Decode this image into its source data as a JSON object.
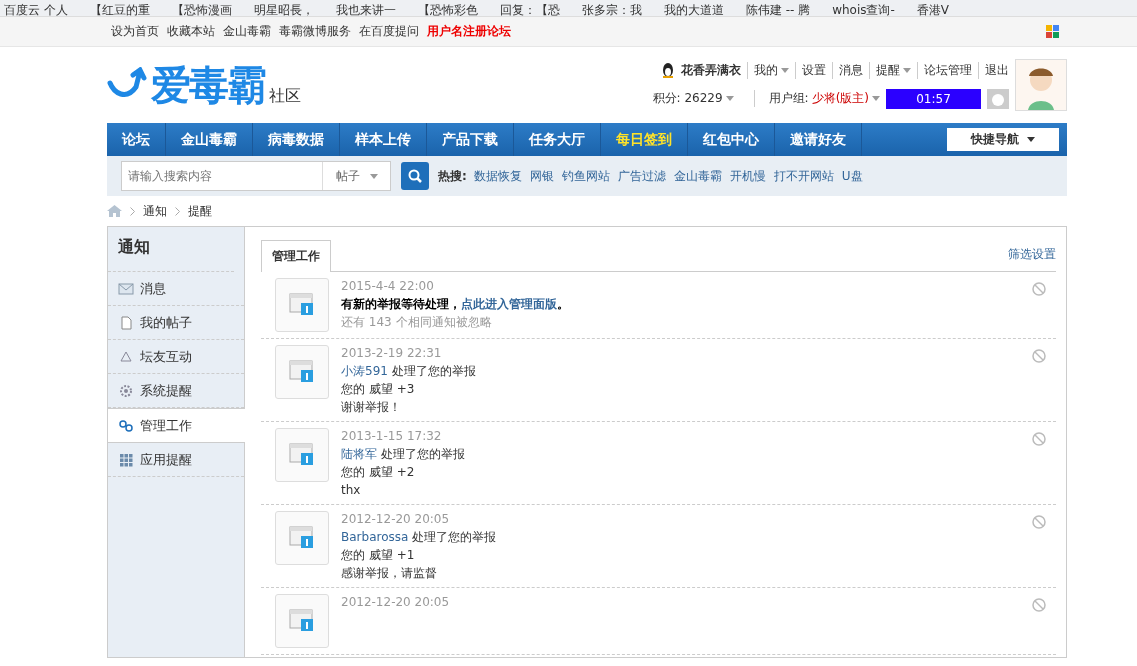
{
  "bookmarks": [
    "百度云 个人",
    "【红豆的重",
    "【恐怖漫画",
    "明星昭長，",
    "我也来讲一",
    "【恐怖彩色",
    "回复：【恐",
    "张多宗：我",
    "我的大道道",
    "陈伟建 -- 腾",
    "whois查询-",
    "香港V"
  ],
  "top_links": [
    {
      "label": "设为首页",
      "emphasis": false
    },
    {
      "label": "收藏本站",
      "emphasis": false
    },
    {
      "label": "金山毒霸",
      "emphasis": false
    },
    {
      "label": "毒霸微博服务",
      "emphasis": false
    },
    {
      "label": "在百度提问",
      "emphasis": false
    },
    {
      "label": "用户名注册论坛",
      "emphasis": true
    }
  ],
  "logo": {
    "name": "爱毒霸",
    "suffix": "社区"
  },
  "user": {
    "name": "花香弄满衣",
    "menu": [
      {
        "label": "我的",
        "dropdown": true
      },
      {
        "label": "设置",
        "dropdown": false
      },
      {
        "label": "消息",
        "dropdown": false
      },
      {
        "label": "提醒",
        "dropdown": true
      },
      {
        "label": "论坛管理",
        "dropdown": false
      },
      {
        "label": "退出",
        "dropdown": false
      }
    ],
    "points": "积分: 26229",
    "group_label": "用户组:",
    "group": "少将(版主)",
    "timer": "01:57"
  },
  "nav": [
    {
      "label": "论坛",
      "highlight": false
    },
    {
      "label": "金山毒霸",
      "highlight": false
    },
    {
      "label": "病毒数据",
      "highlight": false
    },
    {
      "label": "样本上传",
      "highlight": false
    },
    {
      "label": "产品下载",
      "highlight": false
    },
    {
      "label": "任务大厅",
      "highlight": false
    },
    {
      "label": "每日签到",
      "highlight": true
    },
    {
      "label": "红包中心",
      "highlight": false
    },
    {
      "label": "邀请好友",
      "highlight": false
    }
  ],
  "quick_nav": "快捷导航",
  "search": {
    "placeholder": "请输入搜索内容",
    "scope": "帖子",
    "hot_label": "热搜:",
    "hot": [
      "数据恢复",
      "网银",
      "钓鱼网站",
      "广告过滤",
      "金山毒霸",
      "开机慢",
      "打不开网站",
      "U盘"
    ]
  },
  "breadcrumb": [
    "通知",
    "提醒"
  ],
  "sidebar": {
    "title": "通知",
    "items": [
      {
        "label": "消息",
        "selected": false
      },
      {
        "label": "我的帖子",
        "selected": false
      },
      {
        "label": "坛友互动",
        "selected": false
      },
      {
        "label": "系统提醒",
        "selected": false
      },
      {
        "label": "管理工作",
        "selected": true
      },
      {
        "label": "应用提醒",
        "selected": false
      }
    ]
  },
  "tabs": [
    {
      "label": "管理工作",
      "selected": true
    }
  ],
  "filter_link": "筛选设置",
  "notifications": [
    {
      "time": "2015-4-4 22:00",
      "headline": {
        "prefix": "有新的举报等待处理，",
        "link": "点此进入管理面版",
        "suffix": "。",
        "bold": true
      },
      "note": "还有 143 个相同通知被忽略"
    },
    {
      "time": "2013-2-19 22:31",
      "headline": {
        "link": "小涛591",
        "suffix": " 处理了您的举报",
        "bold": false
      },
      "details": [
        "您的 威望 +3",
        "谢谢举报！"
      ]
    },
    {
      "time": "2013-1-15 17:32",
      "headline": {
        "link": "陆将军",
        "suffix": " 处理了您的举报",
        "bold": false
      },
      "details": [
        "您的 威望 +2",
        "thx"
      ]
    },
    {
      "time": "2012-12-20 20:05",
      "headline": {
        "link": "Barbarossa",
        "suffix": " 处理了您的举报",
        "bold": false
      },
      "details": [
        "您的 威望 +1",
        "感谢举报，请监督"
      ]
    },
    {
      "time": "2012-12-20 20:05"
    }
  ]
}
